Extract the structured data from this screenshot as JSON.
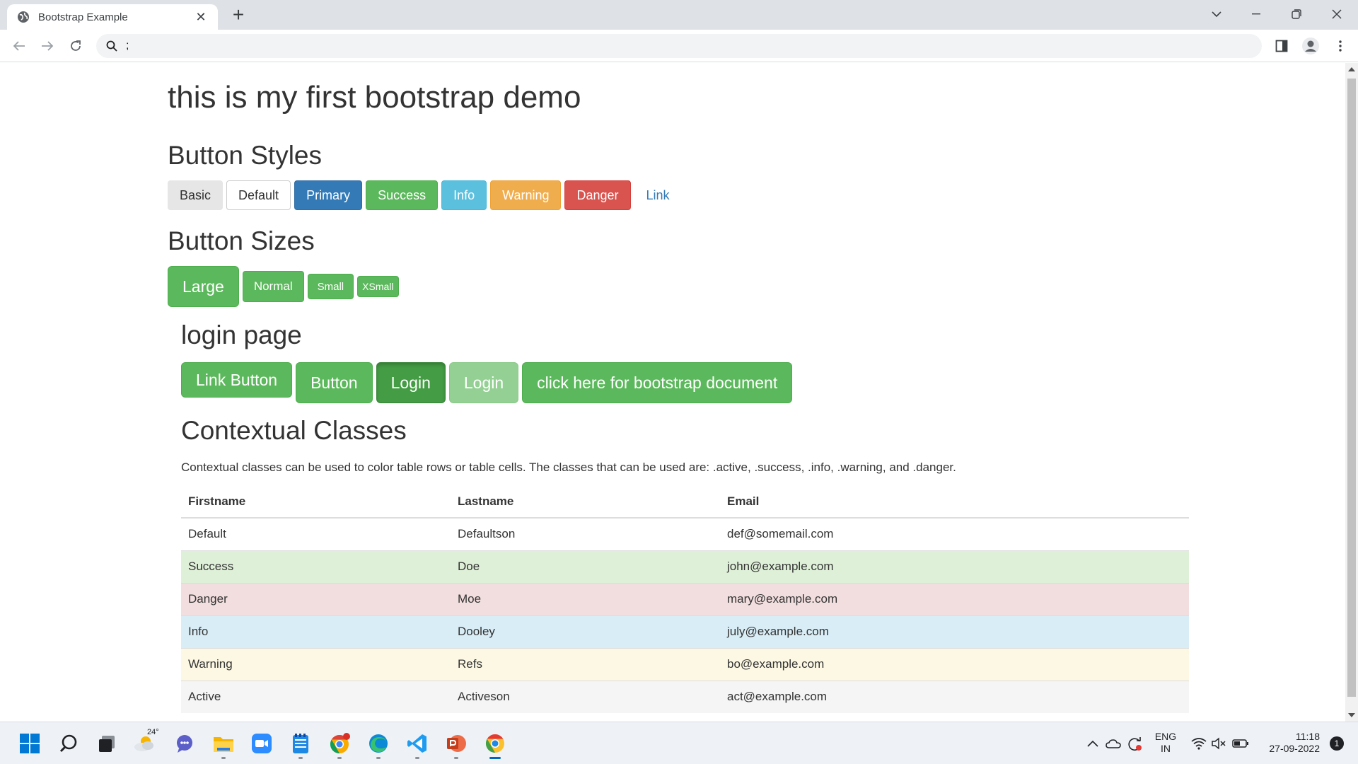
{
  "browser": {
    "tab_title": "Bootstrap Example",
    "new_tab": "+",
    "address": ";"
  },
  "page": {
    "title": "this is my first bootstrap demo",
    "section_styles": "Button Styles",
    "style_buttons": [
      "Basic",
      "Default",
      "Primary",
      "Success",
      "Info",
      "Warning",
      "Danger",
      "Link"
    ],
    "section_sizes": "Button Sizes",
    "size_buttons": [
      "Large",
      "Normal",
      "Small",
      "XSmall"
    ],
    "section_login": "login page",
    "login_buttons": [
      "Link Button",
      "Button",
      "Login",
      "Login",
      "click here for bootstrap document"
    ],
    "section_contextual": "Contextual Classes",
    "contextual_desc": "Contextual classes can be used to color table rows or table cells. The classes that can be used are: .active, .success, .info, .warning, and .danger.",
    "table": {
      "headers": [
        "Firstname",
        "Lastname",
        "Email"
      ],
      "rows": [
        {
          "first": "Default",
          "last": "Defaultson",
          "email": "def@somemail.com"
        },
        {
          "first": "Success",
          "last": "Doe",
          "email": "john@example.com"
        },
        {
          "first": "Danger",
          "last": "Moe",
          "email": "mary@example.com"
        },
        {
          "first": "Info",
          "last": "Dooley",
          "email": "july@example.com"
        },
        {
          "first": "Warning",
          "last": "Refs",
          "email": "bo@example.com"
        },
        {
          "first": "Active",
          "last": "Activeson",
          "email": "act@example.com"
        }
      ]
    }
  },
  "taskbar": {
    "weather_temp": "24°",
    "lang": "ENG",
    "lang_sub": "IN",
    "time": "11:18",
    "date": "27-09-2022",
    "notification_count": "1",
    "icons": [
      "windows-start-icon",
      "search-icon",
      "task-view-icon",
      "weather-icon",
      "teams-chat-icon",
      "file-explorer-icon",
      "zoom-icon",
      "notepad-icon",
      "chrome-canary-icon",
      "edge-icon",
      "vscode-icon",
      "powerpoint-icon",
      "chrome-icon"
    ]
  },
  "colors": {
    "primary": "#337ab7",
    "success": "#5cb85c",
    "info": "#5bc0de",
    "warning": "#f0ad4e",
    "danger": "#d9534f"
  }
}
